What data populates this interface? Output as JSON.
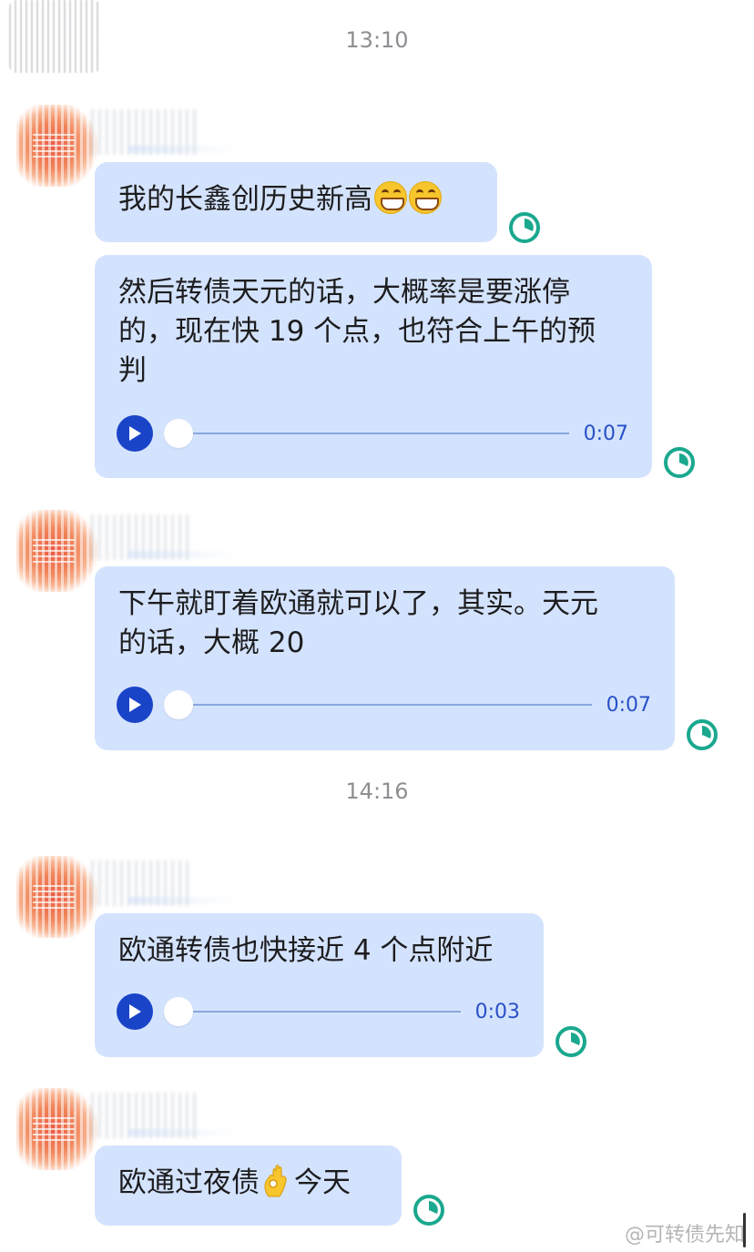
{
  "timestamps": [
    "13:10",
    "14:16"
  ],
  "messages": [
    {
      "text": "我的长鑫创历史新高",
      "emoji": "grinning-face-icon"
    },
    {
      "text": "然后转债天元的话，大概率是要涨停\n的，现在快 19 个点，也符合上午的预\n判",
      "audio_duration": "0:07"
    },
    {
      "text": "下午就盯着欧通就可以了，其实。天元\n的话，大概 20",
      "audio_duration": "0:07"
    },
    {
      "text": "欧通转债也快接近 4 个点附近",
      "audio_duration": "0:03"
    },
    {
      "text_before": "欧通过夜债",
      "emoji": "ok-hand-icon",
      "text_after": "今天"
    }
  ],
  "watermark": "@可转债先知",
  "colors": {
    "bubble": "#d4e3fd",
    "play": "#1a44c8",
    "status": "#1aa88e",
    "duration": "#2850c8",
    "timestamp": "#8e8e93"
  }
}
